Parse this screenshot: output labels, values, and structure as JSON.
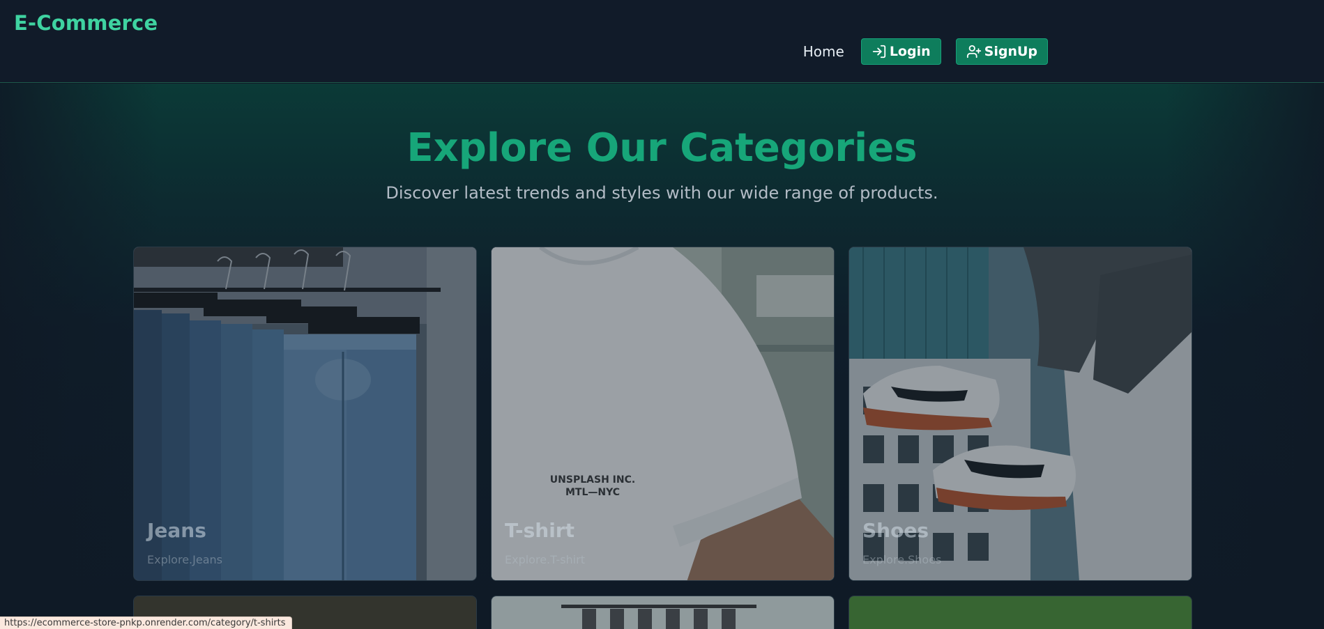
{
  "header": {
    "brand": "E-Commerce",
    "nav": {
      "home": "Home",
      "login": "Login",
      "signup": "SignUp"
    }
  },
  "hero": {
    "title": "Explore Our Categories",
    "subtitle": "Discover latest trends and styles with our wide range of products."
  },
  "categories": [
    {
      "title": "Jeans",
      "link": "Explore.Jeans"
    },
    {
      "title": "T-shirt",
      "link": "Explore.T-shirt"
    },
    {
      "title": "Shoes",
      "link": "Explore.Shoes"
    }
  ],
  "tshirt_print": [
    "UNSPLASH INC.",
    "MTL—NYC"
  ],
  "statusbar": {
    "url": "https://ecommerce-store-pnkp.onrender.com/category/t-shirts"
  },
  "colors": {
    "brand": "#3fd3a1",
    "accent": "#17a679",
    "button": "#0e7d5c",
    "background": "#0f1a26"
  }
}
